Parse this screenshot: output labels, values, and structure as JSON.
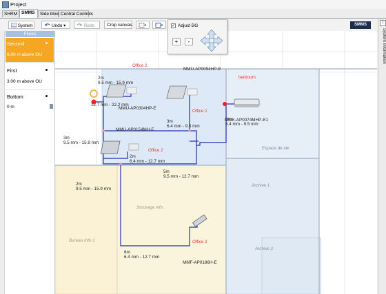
{
  "window": {
    "title": "Project"
  },
  "tabs": [
    {
      "label": "SHRM",
      "active": false
    },
    {
      "label": "SMMS",
      "active": true
    },
    {
      "label": "Side blow",
      "active": false
    },
    {
      "label": "Central Controls",
      "active": false
    }
  ],
  "toolbar": {
    "system_label": "System",
    "undo_label": "Undo",
    "redo_label": "Redo",
    "crop_label": "Crop canvas",
    "brand_logo": "SMMS"
  },
  "popup": {
    "adjust_bg_label": "Adjust BG",
    "adjust_bg_checked": true,
    "zoom_in": "+",
    "zoom_out": "-"
  },
  "floors": {
    "header": "Floors",
    "items": [
      {
        "name": "Second",
        "desc": "6.00 m above OU",
        "selected": true
      },
      {
        "name": "First",
        "desc": "3.00 m above OU",
        "selected": false
      },
      {
        "name": "Bottom",
        "desc": "0 m",
        "selected": false
      }
    ]
  },
  "sidebar": {
    "system_information": "System Information"
  },
  "diagram": {
    "units": [
      {
        "model": "MMU-AP0094HP-E",
        "room": "Office 2"
      },
      {
        "model": "MMU-AP0304HP-E",
        "room": ""
      },
      {
        "model": "MMU-AP0154MH-E",
        "room": "Office 2"
      },
      {
        "model": "MMK-AP0074MHP-E1",
        "room": "bedroom"
      },
      {
        "model": "MMF-AP0186H-E",
        "room": "Office 2"
      }
    ],
    "pipes": [
      {
        "length": "2m",
        "size": "9.5 mm - 15.9 mm"
      },
      {
        "length": "",
        "size": "12.7 mm - 22.2 mm"
      },
      {
        "length": "3m",
        "size": "9.5 mm - 15.9 mm"
      },
      {
        "length": "3m",
        "size": "6.4 mm - 9.5 mm"
      },
      {
        "length": "2m",
        "size": "6.4 mm - 12.7 mm"
      },
      {
        "length": "2m",
        "size": "9.5 mm - 15.9 mm"
      },
      {
        "length": "5m",
        "size": "9.5 mm - 12.7 mm"
      },
      {
        "length": "2m",
        "size": "6.4 mm - 9.5 mm"
      },
      {
        "length": "6m",
        "size": "6.4 mm - 12.7 mm"
      }
    ],
    "floorplan_text": {
      "office_label": "Office 2",
      "bedroom_label": "bedroom",
      "espace": "Espace de vie",
      "archive": "Archive 1",
      "archive2": "Archive 2",
      "stockage": "Stockage info",
      "bureau": "Bureau Info 1"
    },
    "colors": {
      "pipe": "#2233aa",
      "room_blue": "#dde9f7",
      "room_yellow": "#fbf2d6",
      "label_red": "#e33333"
    }
  }
}
